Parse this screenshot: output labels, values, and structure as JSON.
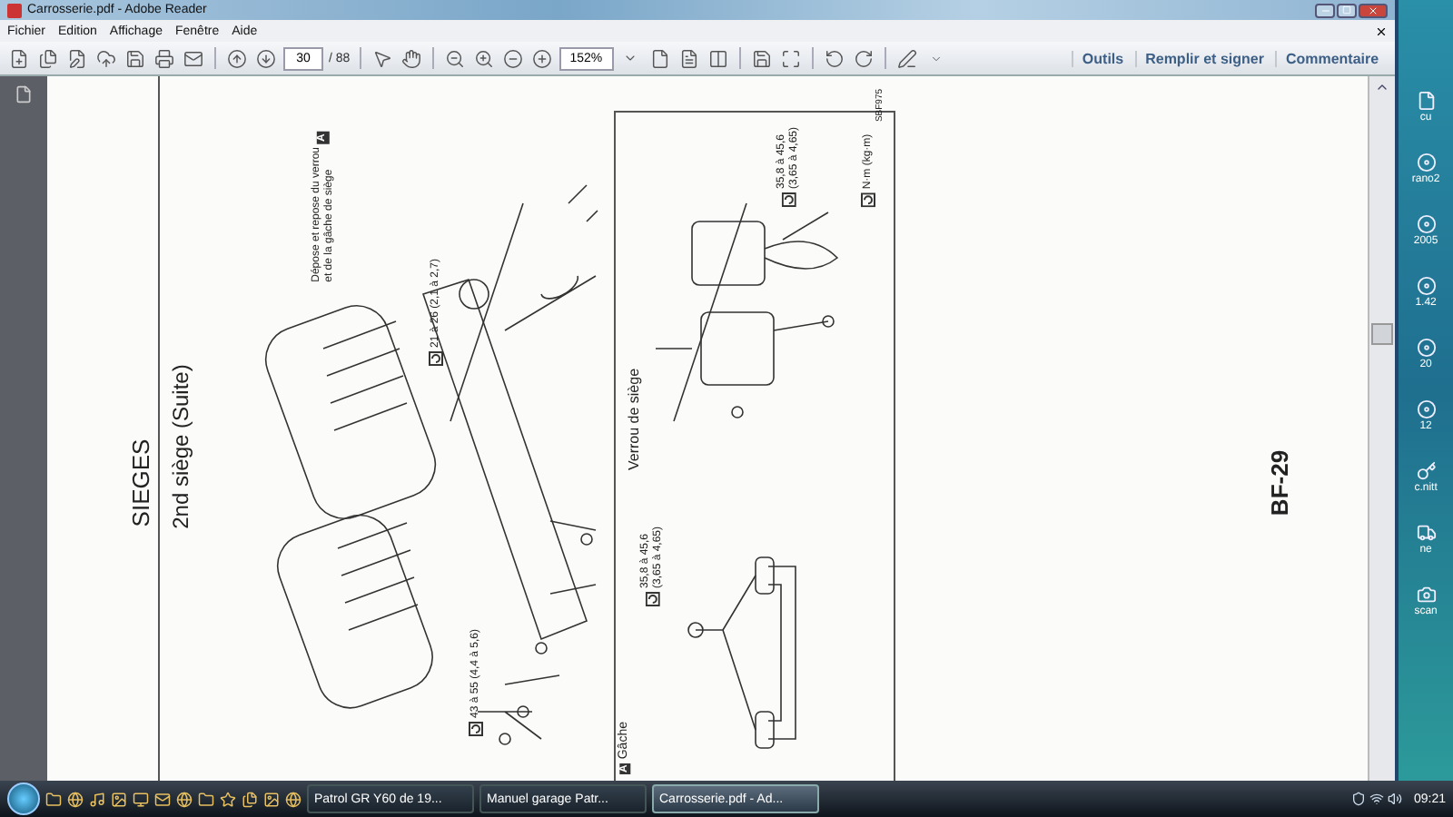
{
  "window": {
    "title": "Carrosserie.pdf - Adobe Reader"
  },
  "menu": [
    "Fichier",
    "Edition",
    "Affichage",
    "Fenêtre",
    "Aide"
  ],
  "toolbar": {
    "page_number": "30",
    "page_count": "/ 88",
    "zoom": "152%",
    "panels": [
      "Outils",
      "Remplir et signer",
      "Commentaire"
    ]
  },
  "document": {
    "section_title": "SIEGES",
    "subtitle": "2nd siège (Suite)",
    "callout": {
      "lines": [
        "Dépose et repose du verrou",
        "et de la gâche de siège"
      ],
      "marker": "A"
    },
    "torque_upper": "21 à 26 (2,1 à 2,7)",
    "torque_lower": "43 à 55 (4,4 à 5,6)",
    "inset": {
      "marker": "A",
      "title": "Gâche",
      "lock_label": "Verrou de siège",
      "torque_strike": [
        "35,8 à 45,6",
        "(3,65 à 4,65)"
      ],
      "torque_lock": [
        "35,8 à 45,6",
        "(3,65 à 4,65)"
      ],
      "unit": "N·m (kg·m)",
      "figure_code": "SBF975"
    },
    "page_label": "BF-29"
  },
  "desktop_icons": [
    {
      "label": "cu"
    },
    {
      "label": "rano2"
    },
    {
      "label": "2005"
    },
    {
      "label": "1.42"
    },
    {
      "label": "20"
    },
    {
      "label": "12"
    },
    {
      "label": "c.nitt"
    },
    {
      "label": "ne"
    },
    {
      "label": "scan"
    }
  ],
  "taskbar": {
    "tasks": [
      {
        "label": "Patrol GR Y60 de 19...",
        "selected": false
      },
      {
        "label": "Manuel garage Patr...",
        "selected": false
      },
      {
        "label": "Carrosserie.pdf - Ad...",
        "selected": true
      }
    ],
    "clock": "09:21"
  }
}
